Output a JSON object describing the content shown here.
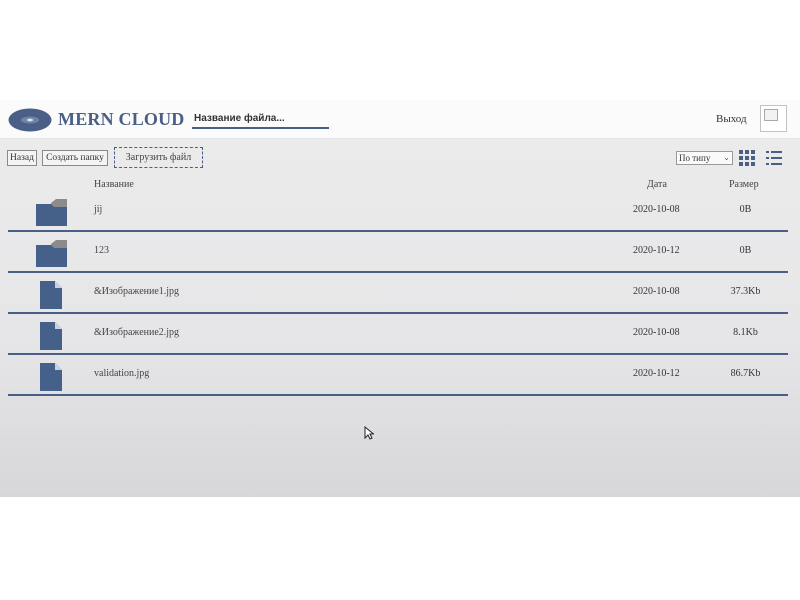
{
  "colors": {
    "accent": "#4a5f86",
    "folder": "#466189",
    "folder_tab": "#8b8b8b"
  },
  "navbar": {
    "brand": "MERN CLOUD",
    "search_placeholder": "Название файла...",
    "logout": "Выход"
  },
  "toolbar": {
    "back_label": "Назад",
    "create_folder_label": "Создать папку",
    "upload_label": "Загрузить файл",
    "sort_selected": "По типу"
  },
  "table": {
    "headers": {
      "name": "Название",
      "date": "Дата",
      "size": "Размер"
    },
    "rows": [
      {
        "type": "folder",
        "icon": "folder-icon",
        "name": "jij",
        "date": "2020-10-08",
        "size": "0B"
      },
      {
        "type": "folder",
        "icon": "folder-icon",
        "name": "123",
        "date": "2020-10-12",
        "size": "0B"
      },
      {
        "type": "file",
        "icon": "file-icon",
        "name": "&Изображение1.jpg",
        "date": "2020-10-08",
        "size": "37.3Kb"
      },
      {
        "type": "file",
        "icon": "file-icon",
        "name": "&Изображение2.jpg",
        "date": "2020-10-08",
        "size": "8.1Kb"
      },
      {
        "type": "file",
        "icon": "file-icon",
        "name": "validation.jpg",
        "date": "2020-10-12",
        "size": "86.7Kb"
      }
    ]
  }
}
